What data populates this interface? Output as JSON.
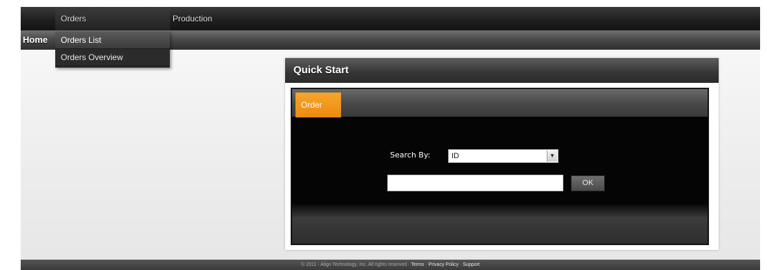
{
  "nav": {
    "home_label": "Home",
    "menus": [
      {
        "label": "Orders"
      },
      {
        "label": "Production"
      }
    ],
    "orders_dropdown": [
      {
        "label": "Orders List"
      },
      {
        "label": "Orders Overview"
      }
    ]
  },
  "quick_start": {
    "title": "Quick Start",
    "tabs": [
      {
        "label": "Order"
      }
    ],
    "search_by_label": "Search By:",
    "search_by_selected": "ID",
    "search_value": "",
    "ok_label": "OK"
  },
  "footer": {
    "copyright": "© 2011 · Align Technology, Inc. All rights reserved ·",
    "links": [
      "Terms",
      "Privacy Policy",
      "Support"
    ]
  },
  "colors": {
    "accent_orange": "#f29a1a",
    "dark_bar": "#1f1f1f"
  }
}
